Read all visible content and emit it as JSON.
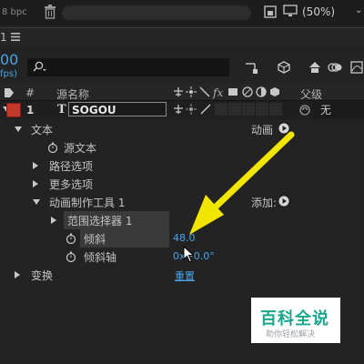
{
  "toolbar": {
    "bpc": "8 bpc",
    "zoom": "(50%)"
  },
  "panel": {
    "close_x": "1",
    "timecode": "00",
    "fps_unit": "fps)"
  },
  "columns": {
    "label_num": "#",
    "source_name": "源名称",
    "parent": "父级"
  },
  "layer": {
    "number": "1",
    "type_glyph": "T",
    "name": "SOGOU",
    "label_color": "#c0392b",
    "parent_value": "无"
  },
  "properties": {
    "text": "文本",
    "animate": "动画",
    "source_text": "源文本",
    "path_options": "路径选项",
    "more_options": "更多选项",
    "animator": "动画制作工具 1",
    "add": "添加:",
    "range_selector": "范围选择器 1",
    "tilt": "倾斜",
    "tilt_value": "48.0",
    "tilt_axis": "倾斜轴",
    "tilt_axis_value": "0x+0.0°",
    "transform": "变换",
    "reset": "重置"
  },
  "watermark": {
    "title": "百科全说",
    "subtitle": "助你轻松解决"
  },
  "colors": {
    "accent_blue": "#4aa3e4",
    "arrow_yellow": "#f2e600",
    "watermark_green": "#1aa58c"
  }
}
